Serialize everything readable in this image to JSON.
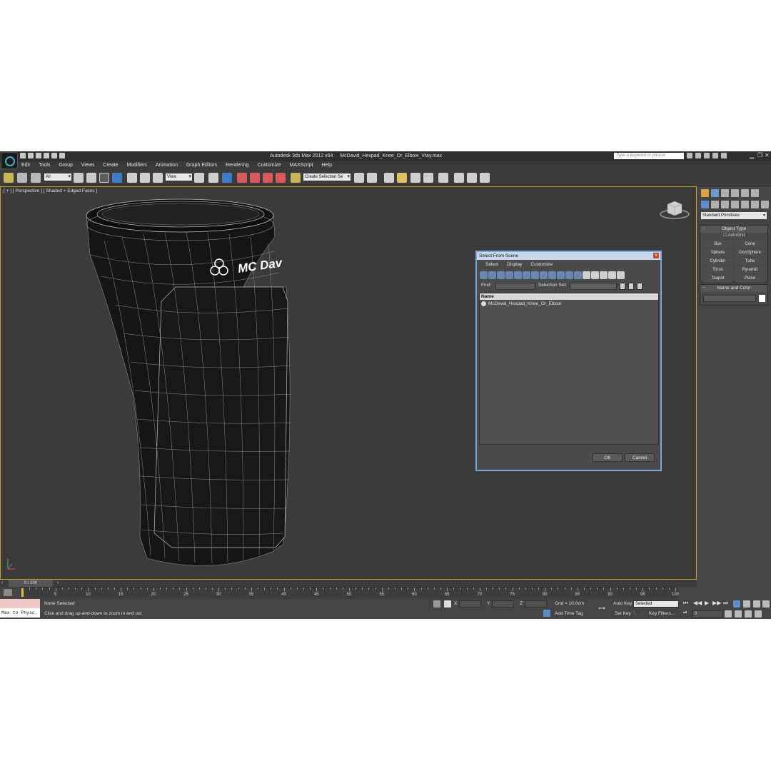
{
  "window": {
    "app_title": "Autodesk 3ds Max  2012 x64",
    "file_title": "McDavid_Hexpad_Knee_Or_Elbow_Vray.max",
    "search_placeholder": "Type a keyword or phrase"
  },
  "menu": [
    "Edit",
    "Tools",
    "Group",
    "Views",
    "Create",
    "Modifiers",
    "Animation",
    "Graph Editors",
    "Rendering",
    "Customize",
    "MAXScript",
    "Help"
  ],
  "toolbar": {
    "filter_value": "All",
    "refcoord_value": "View",
    "selection_set_placeholder": "Create Selection Se"
  },
  "viewport": {
    "label": "[ + ] [ Perspective ] [ Shaded + Edged Faces ]",
    "model_logo_text": "MC Dav"
  },
  "command_panel": {
    "category_value": "Standard Primitives",
    "object_type_title": "Object Type",
    "autogrid_label": "AutoGrid",
    "objects": [
      "Box",
      "Cone",
      "Sphere",
      "GeoSphere",
      "Cylinder",
      "Tube",
      "Torus",
      "Pyramid",
      "Teapot",
      "Plane"
    ],
    "name_color_title": "Name and Color"
  },
  "dialog": {
    "title": "Select From Scene",
    "menu": [
      "Select",
      "Display",
      "Customize"
    ],
    "find_label": "Find:",
    "selection_set_label": "Selection Set:",
    "column_name": "Name",
    "items": [
      "McDavid_Hexpad_Knee_Or_Elbow"
    ],
    "ok_label": "OK",
    "cancel_label": "Cancel"
  },
  "timeline": {
    "frame_display": "0 / 100",
    "current_frame": 0,
    "max_frame": 100,
    "ticks": [
      "5",
      "10",
      "15",
      "20",
      "25",
      "30",
      "35",
      "40",
      "45",
      "50",
      "55",
      "60",
      "65",
      "70",
      "75",
      "80",
      "85",
      "90",
      "95",
      "100"
    ]
  },
  "status": {
    "maxscript_label": "Max to Physc.",
    "selection_status": "None Selected",
    "prompt": "Click and drag up-and-down to zoom in and out",
    "x_label": "X:",
    "y_label": "Y:",
    "z_label": "Z:",
    "grid": "Grid = 10,0cm",
    "add_time_tag": "Add Time Tag",
    "auto_key": "Auto Key",
    "set_key": "Set Key",
    "key_mode_value": "Selected",
    "key_filters": "Key Filters...",
    "frame_field": "0"
  },
  "colors": {
    "viewport_border": "#c4a12e",
    "dialog_border": "#7aa7d6",
    "app_bg": "#444444",
    "viewport_bg": "#3b3b3b"
  }
}
